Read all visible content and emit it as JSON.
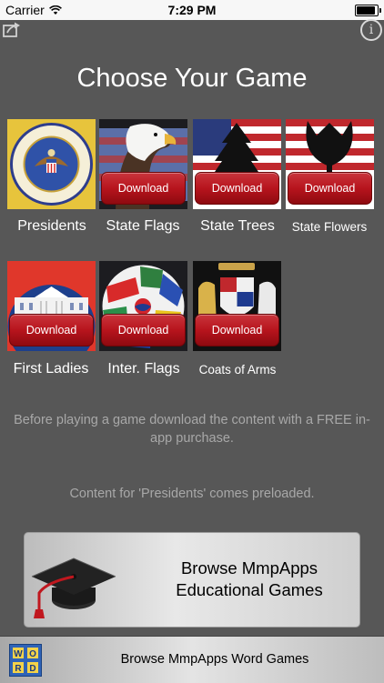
{
  "status": {
    "carrier": "Carrier",
    "time": "7:29 PM",
    "battery_level": 1.0
  },
  "header": {
    "info_glyph": "i",
    "share_icon": "share-icon"
  },
  "title": "Choose Your Game",
  "games": [
    {
      "label": "Presidents",
      "download": ""
    },
    {
      "label": "State Flags",
      "download": "Download"
    },
    {
      "label": "State Trees",
      "download": "Download"
    },
    {
      "label": "State Flowers",
      "download": "Download"
    },
    {
      "label": "First Ladies",
      "download": "Download"
    },
    {
      "label": "Inter. Flags",
      "download": "Download"
    },
    {
      "label": "Coats of Arms",
      "download": "Download"
    }
  ],
  "messages": {
    "purchase": "Before playing a game download the content with a FREE in-app purchase.",
    "preloaded": "Content for 'Presidents' comes preloaded."
  },
  "browse_edu": {
    "line1": "Browse MmpApps",
    "line2": "Educational Games"
  },
  "browse_word": {
    "label": "Browse MmpApps Word Games",
    "icon_letters": [
      "W",
      "O",
      "R",
      "D"
    ]
  }
}
